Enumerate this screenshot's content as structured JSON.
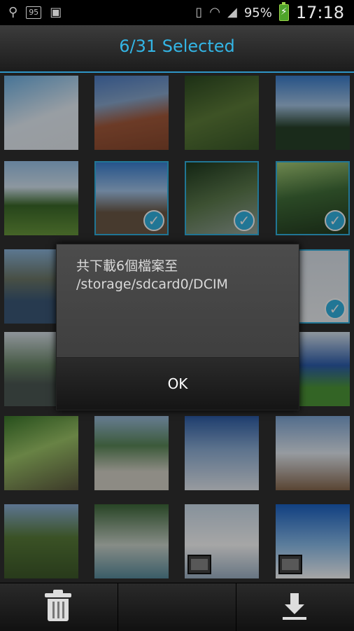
{
  "status_bar": {
    "battery_badge": "95",
    "battery_percent": "95%",
    "time": "17:18",
    "icons": [
      "usb-icon",
      "battery-status-icon",
      "gallery-icon",
      "vibrate-icon",
      "wifi-icon",
      "signal-icon",
      "battery-icon"
    ]
  },
  "header": {
    "title": "6/31 Selected"
  },
  "grid": {
    "thumbnails": [
      {
        "selected": false,
        "video": false
      },
      {
        "selected": false,
        "video": false
      },
      {
        "selected": false,
        "video": false
      },
      {
        "selected": false,
        "video": false
      },
      {
        "selected": false,
        "video": false
      },
      {
        "selected": true,
        "video": false
      },
      {
        "selected": true,
        "video": false
      },
      {
        "selected": true,
        "video": false
      },
      {
        "selected": false,
        "video": false
      },
      {
        "selected": false,
        "video": false
      },
      {
        "selected": false,
        "video": false
      },
      {
        "selected": true,
        "video": false
      },
      {
        "selected": false,
        "video": false
      },
      {
        "selected": false,
        "video": false
      },
      {
        "selected": false,
        "video": false
      },
      {
        "selected": false,
        "video": false
      },
      {
        "selected": false,
        "video": false
      },
      {
        "selected": false,
        "video": false
      },
      {
        "selected": false,
        "video": false
      },
      {
        "selected": false,
        "video": false
      },
      {
        "selected": false,
        "video": false
      },
      {
        "selected": false,
        "video": false
      },
      {
        "selected": false,
        "video": true
      },
      {
        "selected": false,
        "video": true
      }
    ]
  },
  "dialog": {
    "message": "共下載6個檔案至\n/storage/sdcard0/DCIM",
    "ok_label": "OK"
  },
  "bottom_bar": {
    "icons": [
      "trash-icon",
      "download-icon"
    ]
  },
  "colors": {
    "accent": "#33b5e5"
  }
}
